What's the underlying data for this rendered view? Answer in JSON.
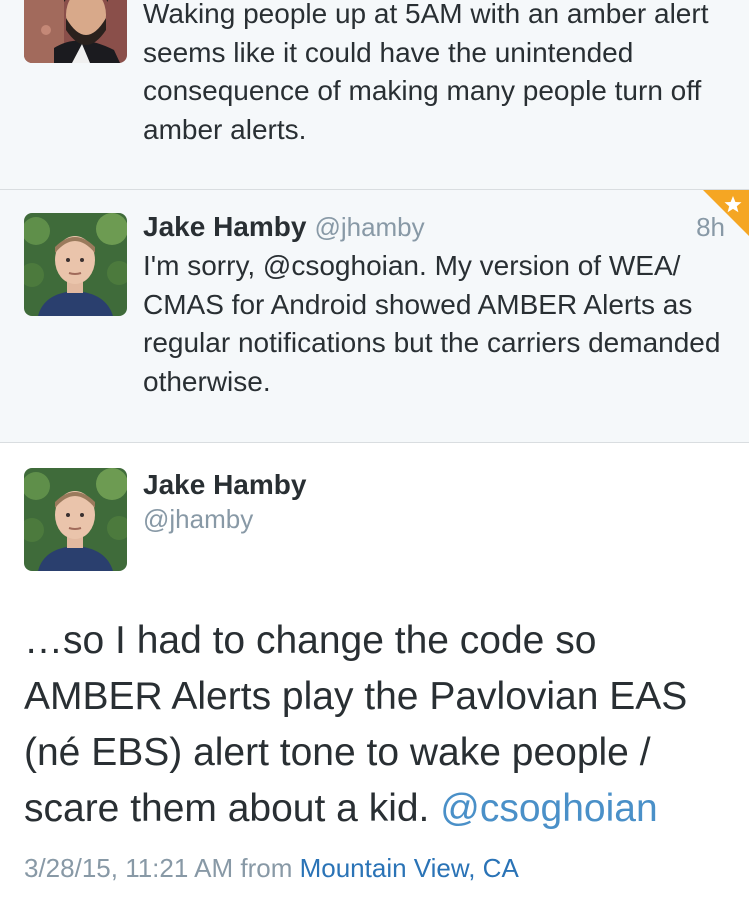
{
  "tweets": [
    {
      "avatar": "bearded-man-avatar",
      "text": "Waking people up at 5AM with an amber alert seems like it could have the unintended consequence of making many people turn off amber alerts."
    },
    {
      "avatar": "jake-hamby-avatar",
      "name": "Jake Hamby",
      "handle": "@jhamby",
      "time": "8h",
      "text": "I'm sorry, @csoghoian. My version of WEA/ CMAS for Android showed AMBER Alerts as regular notifications but the carriers demanded otherwise.",
      "favorited": true
    }
  ],
  "detail": {
    "avatar": "jake-hamby-avatar",
    "name": "Jake Hamby",
    "handle": "@jhamby",
    "text": "…so I had to change the code so AMBER Alerts play the Pavlovian EAS (né EBS) alert tone to wake people / scare them about a kid.",
    "mention": "@csoghoian",
    "timestamp": "3/28/15, 11:21 AM",
    "from_label": "from",
    "location": "Mountain View, CA"
  },
  "colors": {
    "link": "#4a90c8",
    "muted": "#8899a6",
    "favorite": "#f5a623"
  }
}
